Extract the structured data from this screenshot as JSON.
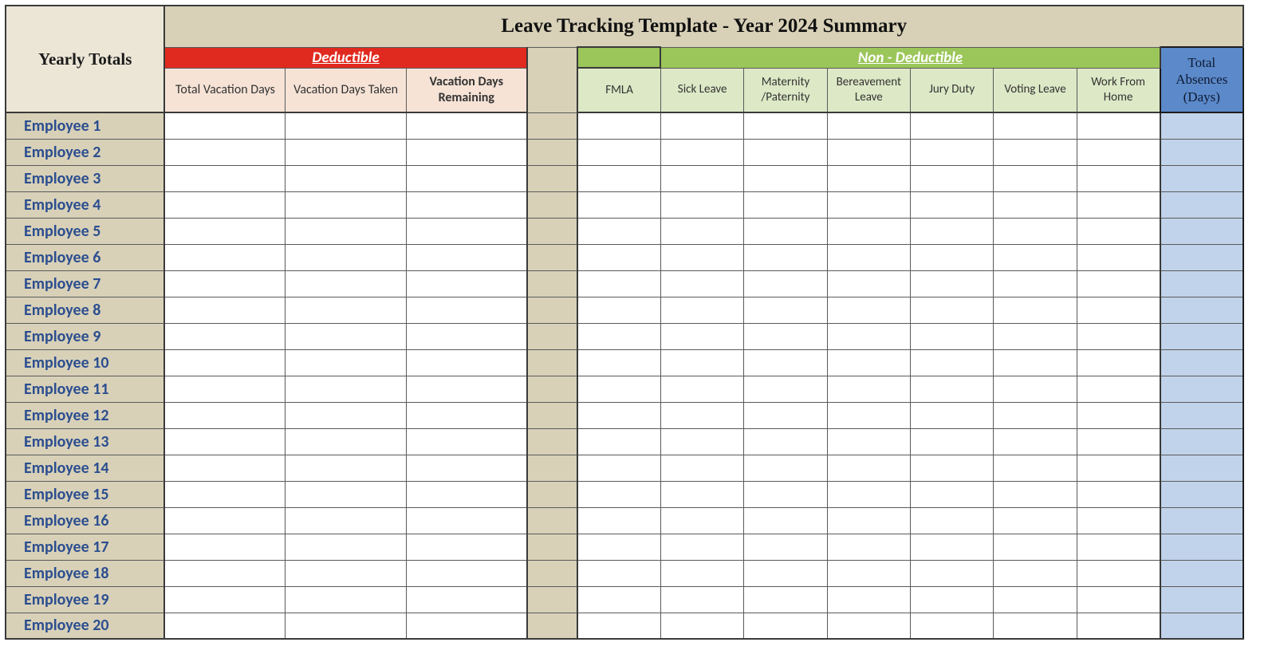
{
  "title": "Leave Tracking Template - Year 2024 Summary",
  "yearly_totals_label": "Yearly Totals",
  "deductible": {
    "header": "Deductible",
    "cols": [
      "Total Vacation Days",
      "Vacation Days Taken",
      "Vacation Days Remaining"
    ]
  },
  "nondeductible": {
    "header": "Non - Deductible",
    "cols": [
      "FMLA",
      "Sick Leave",
      "Maternity /Paternity",
      "Bereavement Leave",
      "Jury Duty",
      "Voting Leave",
      "Work From Home"
    ]
  },
  "total_absences_label": "Total Absences (Days)",
  "employees": [
    "Employee 1",
    "Employee 2",
    "Employee 3",
    "Employee 4",
    "Employee 5",
    "Employee 6",
    "Employee 7",
    "Employee 8",
    "Employee 9",
    "Employee 10",
    "Employee 11",
    "Employee 12",
    "Employee 13",
    "Employee 14",
    "Employee 15",
    "Employee 16",
    "Employee 17",
    "Employee 18",
    "Employee 19",
    "Employee 20"
  ]
}
